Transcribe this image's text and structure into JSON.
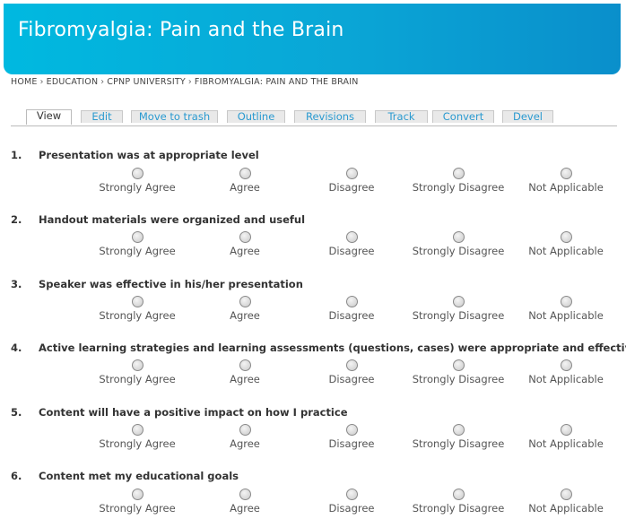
{
  "header": {
    "title": "Fibromyalgia: Pain and the Brain"
  },
  "breadcrumb": [
    "HOME",
    "EDUCATION",
    "CPNP UNIVERSITY",
    "FIBROMYALGIA: PAIN AND THE BRAIN"
  ],
  "breadcrumb_separator": "›",
  "tabs": [
    {
      "label": "View",
      "active": true
    },
    {
      "label": "Edit"
    },
    {
      "label": "Move to trash"
    },
    {
      "label": "Outline"
    },
    {
      "label": "Revisions"
    },
    {
      "label": "Track"
    },
    {
      "label": "Convert"
    },
    {
      "label": "Devel"
    }
  ],
  "options": [
    "Strongly Agree",
    "Agree",
    "Disagree",
    "Strongly Disagree",
    "Not Applicable"
  ],
  "questions": [
    {
      "num": "1.",
      "text": "Presentation was at appropriate level"
    },
    {
      "num": "2.",
      "text": "Handout materials were organized and useful"
    },
    {
      "num": "3.",
      "text": "Speaker was effective in his/her presentation"
    },
    {
      "num": "4.",
      "text": "Active learning strategies and learning assessments (questions, cases) were appropriate and effective"
    },
    {
      "num": "5.",
      "text": "Content will have a positive impact on how I practice"
    },
    {
      "num": "6.",
      "text": "Content met my educational goals"
    }
  ],
  "colors": {
    "banner": "#00b9e0",
    "tab_link": "#2a9ad0"
  }
}
